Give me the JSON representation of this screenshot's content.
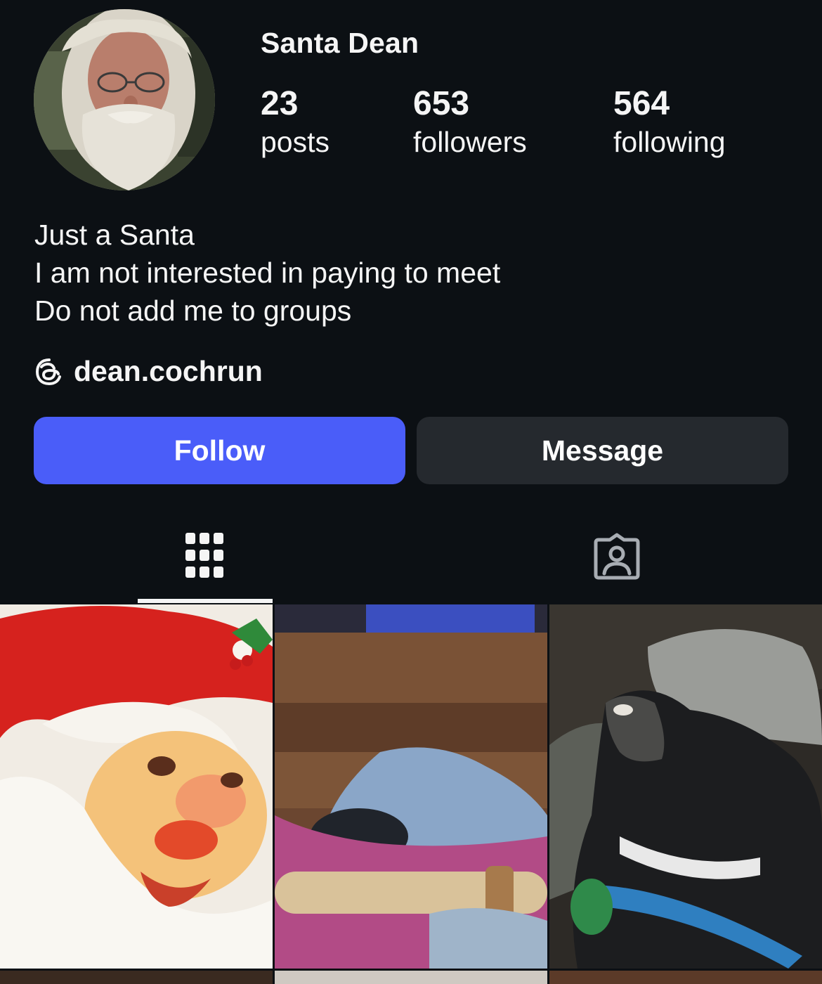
{
  "profile": {
    "name": "Santa Dean",
    "stats": {
      "posts": {
        "count": "23",
        "label": "posts"
      },
      "followers": {
        "count": "653",
        "label": "followers"
      },
      "following": {
        "count": "564",
        "label": "following"
      }
    },
    "bio": [
      "Just a Santa",
      "I am not interested in paying to meet",
      "Do not add me to groups"
    ],
    "threads_handle": "dean.cochrun"
  },
  "actions": {
    "follow_label": "Follow",
    "message_label": "Message"
  },
  "tabs": [
    {
      "icon": "grid-icon",
      "active": true
    },
    {
      "icon": "tagged-icon",
      "active": false
    }
  ],
  "icons": {
    "threads": "threads-icon",
    "avatar": "profile-photo"
  },
  "colors": {
    "background": "#0c1014",
    "follow_button": "#4a5df9",
    "message_button": "#25292e",
    "text": "#f5f5f5"
  }
}
